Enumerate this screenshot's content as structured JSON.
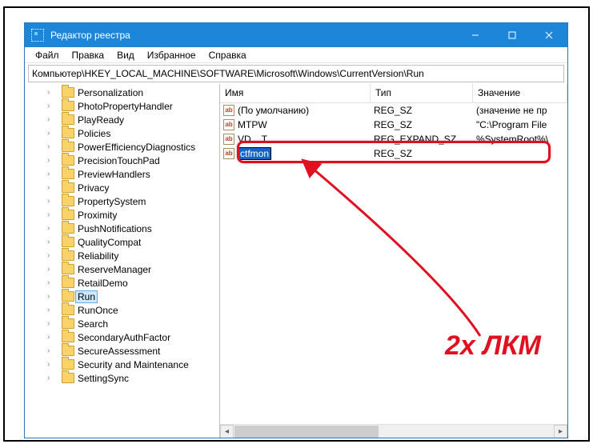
{
  "window": {
    "title": "Редактор реестра"
  },
  "menu": {
    "file": "Файл",
    "edit": "Правка",
    "view": "Вид",
    "favorites": "Избранное",
    "help": "Справка"
  },
  "address": "Компьютер\\HKEY_LOCAL_MACHINE\\SOFTWARE\\Microsoft\\Windows\\CurrentVersion\\Run",
  "tree": {
    "items": [
      "Personalization",
      "PhotoPropertyHandler",
      "PlayReady",
      "Policies",
      "PowerEfficiencyDiagnostics",
      "PrecisionTouchPad",
      "PreviewHandlers",
      "Privacy",
      "PropertySystem",
      "Proximity",
      "PushNotifications",
      "QualityCompat",
      "Reliability",
      "ReserveManager",
      "RetailDemo",
      "Run",
      "RunOnce",
      "Search",
      "SecondaryAuthFactor",
      "SecureAssessment",
      "Security and Maintenance",
      "SettingSync"
    ],
    "selected_index": 15
  },
  "list": {
    "columns": {
      "name": "Имя",
      "type": "Тип",
      "value": "Значение"
    },
    "rows": [
      {
        "name": "(По умолчанию)",
        "type": "REG_SZ",
        "value": "(значение не пр"
      },
      {
        "name": "MTPW",
        "type": "REG_SZ",
        "value": "\"C:\\Program File"
      },
      {
        "name": "VD... T",
        "type": "REG_EXPAND_SZ",
        "value": "%SystemRoot%\\"
      },
      {
        "name": "ctfmon",
        "type": "REG_SZ",
        "value": ""
      }
    ],
    "editing_index": 3
  },
  "annotation": {
    "label": "2х ЛКМ"
  }
}
